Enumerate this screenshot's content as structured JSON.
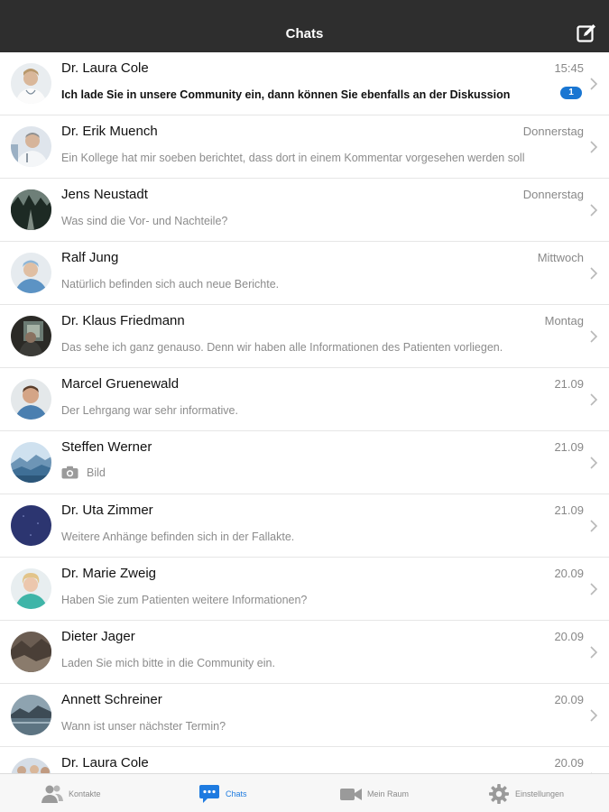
{
  "header": {
    "title": "Chats",
    "compose_icon": "compose-icon"
  },
  "chats": [
    {
      "name": "Dr. Laura Cole",
      "time": "15:45",
      "preview": "Ich lade Sie in unsere Community ein, dann können Sie ebenfalls an der Diskussion",
      "unread": "1"
    },
    {
      "name": "Dr. Erik Muench",
      "time": "Donnerstag",
      "preview": "Ein Kollege hat mir soeben berichtet, dass dort in einem Kommentar vorgesehen werden soll"
    },
    {
      "name": "Jens Neustadt",
      "time": "Donnerstag",
      "preview": "Was sind die Vor- und Nachteile?"
    },
    {
      "name": "Ralf Jung",
      "time": "Mittwoch",
      "preview": "Natürlich befinden sich auch neue Berichte."
    },
    {
      "name": "Dr. Klaus Friedmann",
      "time": "Montag",
      "preview": "Das sehe ich ganz genauso. Denn wir haben alle Informationen des Patienten vorliegen."
    },
    {
      "name": "Marcel Gruenewald",
      "time": "21.09",
      "preview": "Der Lehrgang war sehr informative."
    },
    {
      "name": "Steffen Werner",
      "time": "21.09",
      "preview": "Bild",
      "attachment_icon": "camera-icon"
    },
    {
      "name": "Dr. Uta Zimmer",
      "time": "21.09",
      "preview": "Weitere Anhänge befinden sich in der Fallakte."
    },
    {
      "name": "Dr. Marie Zweig",
      "time": "20.09",
      "preview": "Haben Sie zum Patienten weitere Informationen?"
    },
    {
      "name": "Dieter Jager",
      "time": "20.09",
      "preview": "Laden Sie mich bitte in die Community ein."
    },
    {
      "name": "Annett Schreiner",
      "time": "20.09",
      "preview": "Wann ist unser nächster Termin?"
    },
    {
      "name": "Dr. Laura Cole",
      "time": "20.09",
      "preview": ""
    }
  ],
  "tabs": [
    {
      "label": "Kontakte",
      "icon": "contacts-icon"
    },
    {
      "label": "Chats",
      "icon": "chat-bubble-icon",
      "active": true
    },
    {
      "label": "Mein Raum",
      "icon": "video-camera-icon"
    },
    {
      "label": "Einstellungen",
      "icon": "gear-icon"
    }
  ],
  "colors": {
    "header_bg": "#2e2e2e",
    "accent": "#1e7be0",
    "badge": "#1976d2"
  }
}
